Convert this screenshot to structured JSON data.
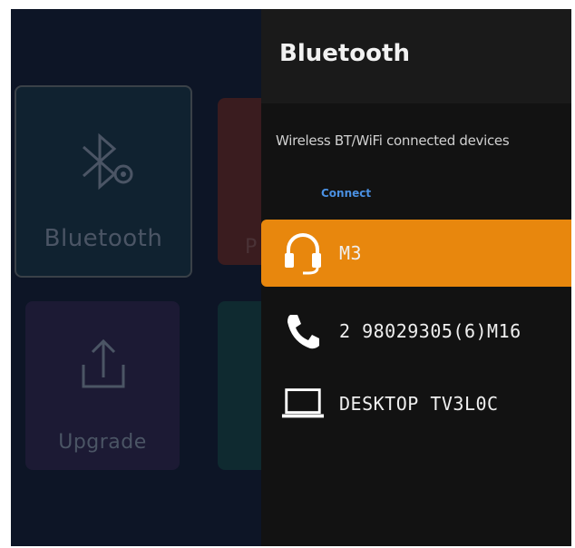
{
  "tiles": {
    "bluetooth_label": "Bluetooth",
    "red_partial_label": "P",
    "upgrade_label": "Upgrade"
  },
  "panel": {
    "title": "Bluetooth",
    "subtitle": "Wireless BT/WiFi connected devices",
    "link": "Connect",
    "devices": [
      {
        "name": "M3",
        "icon": "headset-icon",
        "selected": true
      },
      {
        "name": "2 98029305(6)M16",
        "icon": "phone-icon",
        "selected": false
      },
      {
        "name": "DESKTOP TV3L0C",
        "icon": "laptop-icon",
        "selected": false
      }
    ]
  },
  "colors": {
    "background": "#0d1526",
    "panel": "#121212",
    "accent": "#e8870d",
    "link": "#4a90e2"
  }
}
